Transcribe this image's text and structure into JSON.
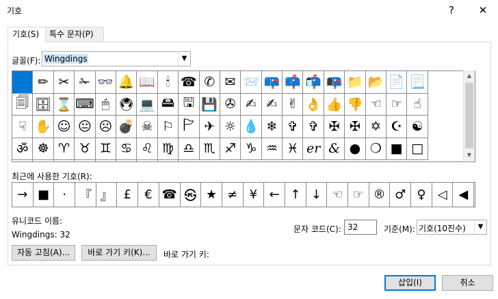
{
  "window": {
    "title": "기호",
    "help_label": "?",
    "close_label": "✕"
  },
  "tabs": [
    {
      "label": "기호(S)"
    },
    {
      "label": "특수 문자(P)"
    }
  ],
  "font": {
    "label": "글꼴(F):",
    "value": "Wingdings"
  },
  "symbols": [
    "",
    "✏",
    "✂",
    "✁",
    "👓",
    "🔔",
    "📖",
    "🕯",
    "☎",
    "✆",
    "✉",
    "📨",
    "📪",
    "📫",
    "📬",
    "📭",
    "📁",
    "📂",
    "📄",
    "📃",
    "🗐",
    "🗄",
    "⌛",
    "⌨",
    "🖱",
    "🖲",
    "💻",
    "🖴",
    "🖫",
    "💾",
    "✇",
    "✍",
    "✍",
    "✌",
    "👌",
    "👍",
    "👎",
    "☜",
    "☞",
    "☝",
    "☟",
    "✋",
    "☺",
    "😐",
    "☹",
    "💣",
    "☠",
    "⚐",
    "🏱",
    "✈",
    "☼",
    "💧",
    "❄",
    "✞",
    "✞",
    "✠",
    "✠",
    "✡",
    "☪",
    "☯",
    "ॐ",
    "☸",
    "♈",
    "♉",
    "♊",
    "♋",
    "♌",
    "♍",
    "♎",
    "♏",
    "♐",
    "♑",
    "♒",
    "♓",
    "er",
    "&",
    "●",
    "❍",
    "■",
    "□",
    "◻",
    "❑",
    "❒",
    "⬧",
    "⧫",
    "◆",
    "❖",
    "⬥"
  ],
  "recent": {
    "label": "최근에 사용한 기호(R):",
    "items": [
      "→",
      "■",
      "·",
      "『",
      "』",
      "£",
      "€",
      "☎",
      "㉿",
      "★",
      "≠",
      "¥",
      "←",
      "↑",
      "↓",
      "☜",
      "☞",
      "®",
      "♂",
      "♀",
      "◁",
      "◀"
    ]
  },
  "unicode_name": {
    "label": "유니코드 이름:",
    "value": "Wingdings: 32"
  },
  "char_code": {
    "label": "문자 코드(C):",
    "value": "32"
  },
  "from": {
    "label": "기준(M):",
    "value": "기호(10진수)"
  },
  "buttons": {
    "autocorrect": "자동 고침(A)...",
    "shortcut": "바로 가기 키(K)...",
    "shortcut_text": "바로 가기 키:",
    "insert": "삽입(I)",
    "cancel": "취소"
  }
}
